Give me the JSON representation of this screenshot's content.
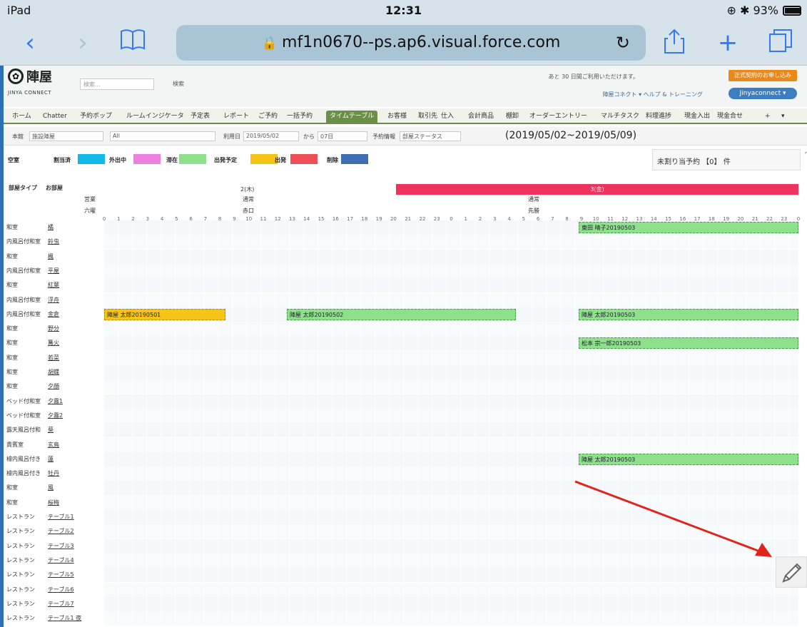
{
  "status": {
    "device": "iPad",
    "time": "12:31",
    "right": "⊕ ✱ 93%",
    "battery_level": 0.93
  },
  "browser": {
    "url": "mf1n0670--ps.ap6.visual.force.com"
  },
  "header": {
    "brand": "陣屋",
    "brand_sub": "JINYA CONNECT",
    "search_placeholder": "検索...",
    "search_button": "検索",
    "trial_note": "あと 30 日間ご利用いただけます。",
    "contract_button": "正式契約のお申し込み",
    "links": "陣屋コネクト ▾   ヘルプ & トレーニング",
    "user_menu": "Jinyaconnect ▾"
  },
  "tabs": [
    "ホーム",
    "Chatter",
    "予約ボップ",
    "ルームインジケータ",
    "予定表",
    "レポート",
    "ご予約",
    "一括予約",
    "タイムテーブル",
    "お客様",
    "取引先",
    "仕入",
    "会計商品",
    "棚卸",
    "オーダーエントリー",
    "マルチタスク",
    "料理進捗",
    "現金入出",
    "現金合せ",
    "+",
    "▾"
  ],
  "active_tab": "タイムテーブル",
  "filters": {
    "building": "本館",
    "building_value": "施設陣屋",
    "all": "All",
    "date_label": "利用日",
    "date_value": "2019/05/02",
    "from": "から",
    "days": "07日",
    "status_label": "予約情報",
    "status_value": "部屋ステータス",
    "range": "(2019/05/02~2019/05/09)"
  },
  "legend": [
    {
      "label": "空室",
      "color": "#ffffff"
    },
    {
      "label": "割当済",
      "color": "#12b8e8"
    },
    {
      "label": "外出中",
      "color": "#ec7fe0"
    },
    {
      "label": "滞在",
      "color": "#8ee08a"
    },
    {
      "label": "出発予定",
      "color": "#f6c416"
    },
    {
      "label": "出発",
      "color": "#ee4e57"
    },
    {
      "label": "削除",
      "color": "#3f6eb5"
    }
  ],
  "unassigned": "未割り当予約 【0】 件",
  "timetable": {
    "room_type_col": "部屋タイプ",
    "room_col": "お部屋",
    "day_headers": [
      {
        "label": "2(木)",
        "sub1": "通常",
        "sub2": "赤口"
      },
      {
        "label": "3(金)",
        "sub1": "通常",
        "sub2": "先勝"
      }
    ],
    "side_labels": [
      "営業",
      "六曜"
    ],
    "hours": [
      "0",
      "1",
      "2",
      "3",
      "4",
      "5",
      "6",
      "7",
      "8",
      "9",
      "10",
      "11",
      "12",
      "13",
      "14",
      "15",
      "16",
      "17",
      "18",
      "19",
      "20",
      "21",
      "22",
      "23",
      "0",
      "1",
      "2",
      "3",
      "4",
      "5",
      "6",
      "7",
      "8",
      "9",
      "10",
      "11",
      "12",
      "13",
      "14",
      "15",
      "16",
      "17",
      "18",
      "19",
      "20",
      "21",
      "22",
      "23",
      "0"
    ],
    "rows": [
      {
        "type": "和室",
        "name": "橘"
      },
      {
        "type": "内風呂付和室",
        "name": "鈴虫"
      },
      {
        "type": "和室",
        "name": "楓"
      },
      {
        "type": "内風呂付和室",
        "name": "平屋"
      },
      {
        "type": "和室",
        "name": "紅葉"
      },
      {
        "type": "内風呂付和室",
        "name": "浮舟"
      },
      {
        "type": "内風呂付和室",
        "name": "金倉"
      },
      {
        "type": "和室",
        "name": "野分"
      },
      {
        "type": "和室",
        "name": "篝火"
      },
      {
        "type": "和室",
        "name": "若菜"
      },
      {
        "type": "和室",
        "name": "胡蝶"
      },
      {
        "type": "和室",
        "name": "夕顔"
      },
      {
        "type": "ベッド付和室",
        "name": "夕霧1"
      },
      {
        "type": "ベッド付和室",
        "name": "夕霧2"
      },
      {
        "type": "露天風呂付和",
        "name": "葵"
      },
      {
        "type": "貴賓室",
        "name": "玄鳥"
      },
      {
        "type": "檜内風呂付き",
        "name": "蓮"
      },
      {
        "type": "檜内風呂付き",
        "name": "牡丹"
      },
      {
        "type": "和室",
        "name": "風"
      },
      {
        "type": "和室",
        "name": "桜梅"
      },
      {
        "type": "レストラン",
        "name": "テーブル1"
      },
      {
        "type": "レストラン",
        "name": "テーブル2"
      },
      {
        "type": "レストラン",
        "name": "テーブル3"
      },
      {
        "type": "レストラン",
        "name": "テーブル4"
      },
      {
        "type": "レストラン",
        "name": "テーブル5"
      },
      {
        "type": "レストラン",
        "name": "テーブル6"
      },
      {
        "type": "レストラン",
        "name": "テーブル7"
      },
      {
        "type": "レストラン",
        "name": "テーブル1 夜"
      }
    ],
    "bookings": [
      {
        "row": 0,
        "label": "東田 晴子20190503",
        "status": "滞在"
      },
      {
        "row": 6,
        "label": "陣屋 太郎20190501",
        "status": "出発予定"
      },
      {
        "row": 6,
        "label": "陣屋 太郎20190502",
        "status": "滞在"
      },
      {
        "row": 6,
        "label": "陣屋 太郎20190503",
        "status": "滞在"
      },
      {
        "row": 8,
        "label": "松本 宗一郎20190503",
        "status": "滞在"
      },
      {
        "row": 16,
        "label": "陣屋 太郎20190503",
        "status": "滞在"
      }
    ]
  }
}
